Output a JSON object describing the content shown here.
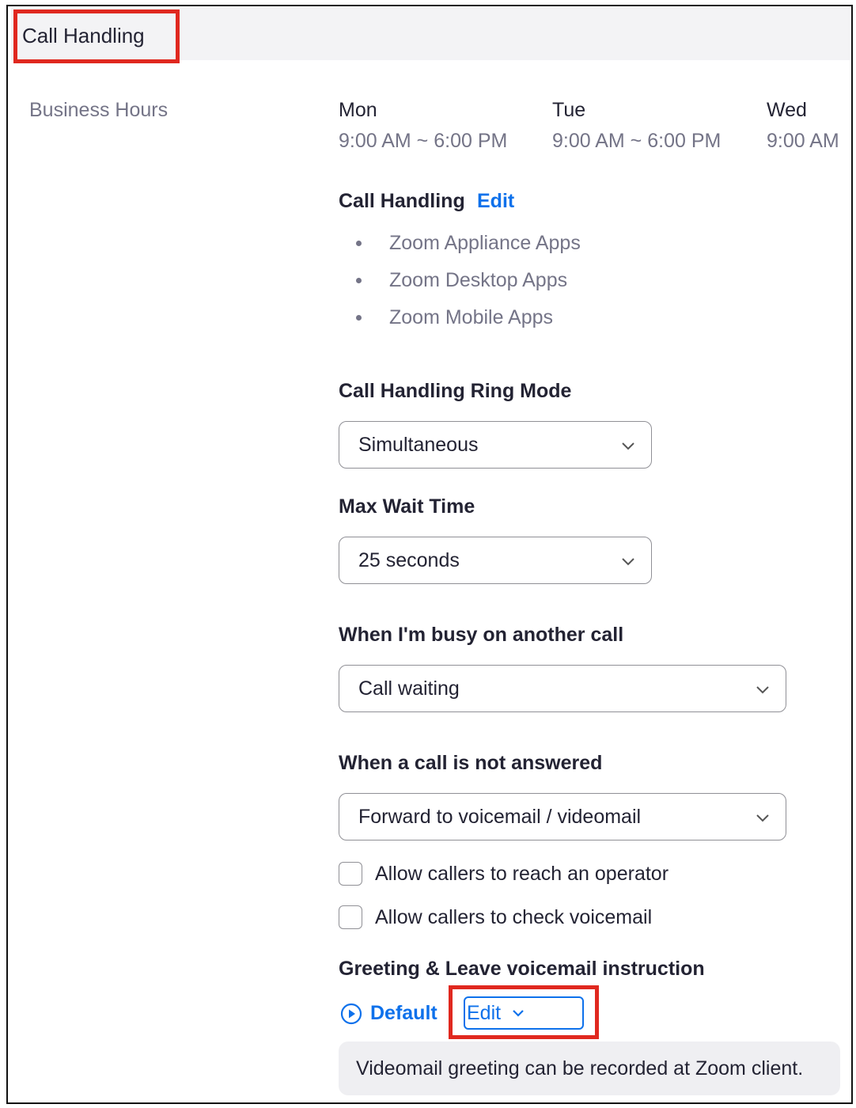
{
  "header": {
    "tab_title": "Call Handling"
  },
  "business_hours": {
    "label": "Business Hours",
    "days": [
      {
        "name": "Mon",
        "hours": "9:00 AM ~ 6:00 PM"
      },
      {
        "name": "Tue",
        "hours": "9:00 AM ~ 6:00 PM"
      },
      {
        "name": "Wed",
        "hours": "9:00 AM"
      }
    ]
  },
  "call_handling": {
    "title": "Call Handling",
    "edit_label": "Edit",
    "apps": [
      "Zoom Appliance Apps",
      "Zoom Desktop Apps",
      "Zoom Mobile Apps"
    ]
  },
  "ring_mode": {
    "label": "Call Handling Ring Mode",
    "value": "Simultaneous"
  },
  "max_wait": {
    "label": "Max Wait Time",
    "value": "25 seconds"
  },
  "busy": {
    "label": "When I'm busy on another call",
    "value": "Call waiting"
  },
  "not_answered": {
    "label": "When a call is not answered",
    "value": "Forward to voicemail / videomail"
  },
  "options": {
    "reach_operator": {
      "label": "Allow callers to reach an operator",
      "checked": false
    },
    "check_voicemail": {
      "label": "Allow callers to check voicemail",
      "checked": false
    }
  },
  "greeting": {
    "label": "Greeting & Leave voicemail instruction",
    "default_label": "Default",
    "edit_label": "Edit",
    "note": "Videomail greeting can be recorded at Zoom client."
  },
  "icons": {
    "play": "play-circle-icon",
    "chevron": "chevron-down-icon"
  },
  "colors": {
    "link": "#0e71eb",
    "highlight": "#e0281f"
  }
}
